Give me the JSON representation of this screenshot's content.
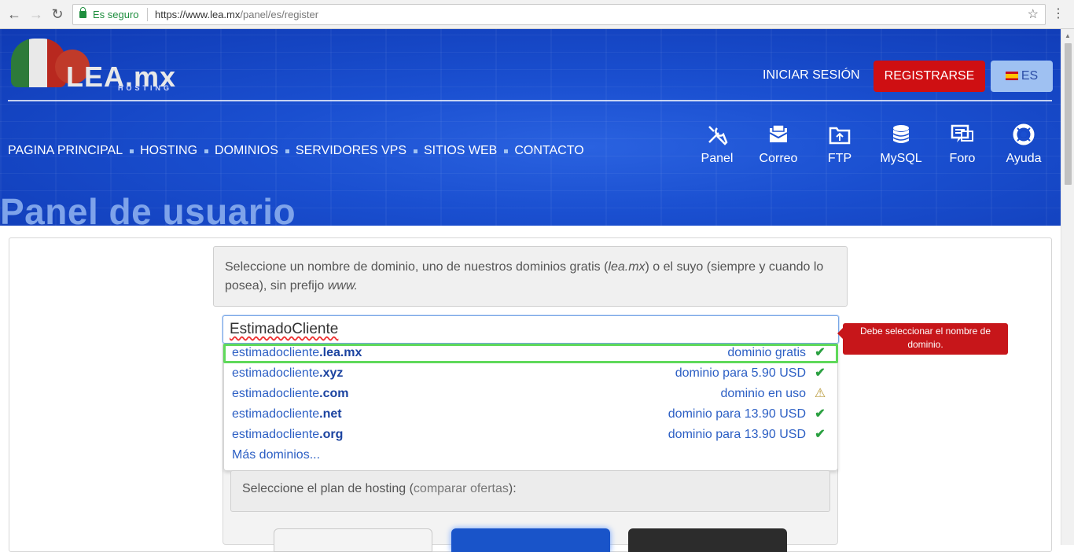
{
  "browser": {
    "secure_label": "Es seguro",
    "url_host": "https://www.lea.mx",
    "url_path": "/panel/es/register"
  },
  "header": {
    "logo_text": "LEA.mx",
    "logo_sub": "HOSTING",
    "login": "INICIAR SESIÓN",
    "register": "REGISTRARSE",
    "language": "ES"
  },
  "nav": [
    "PAGINA PRINCIPAL",
    "HOSTING",
    "DOMINIOS",
    "SERVIDORES VPS",
    "SITIOS WEB",
    "CONTACTO"
  ],
  "tools": [
    {
      "label": "Panel",
      "icon": "tools-icon"
    },
    {
      "label": "Correo",
      "icon": "mail-icon"
    },
    {
      "label": "FTP",
      "icon": "folder-icon"
    },
    {
      "label": "MySQL",
      "icon": "database-icon"
    },
    {
      "label": "Foro",
      "icon": "forum-icon"
    },
    {
      "label": "Ayuda",
      "icon": "lifebuoy-icon"
    }
  ],
  "page_title": "Panel de usuario",
  "intro": {
    "text_before": "Seleccione un nombre de dominio, uno de nuestros dominios gratis (",
    "free_domain": "lea.mx",
    "text_middle": ") o el suyo (siempre y cuando lo posea), sin prefijo ",
    "prefix": "www."
  },
  "domain_input": {
    "value": "EstimadoCliente"
  },
  "tooltip": "Debe seleccionar el nombre de dominio.",
  "domain_options": [
    {
      "name": "estimadocliente",
      "tld": ".lea.mx",
      "status": "dominio gratis",
      "icon": "check-icon"
    },
    {
      "name": "estimadocliente",
      "tld": ".xyz",
      "status": "dominio para 5.90 USD",
      "icon": "check-icon"
    },
    {
      "name": "estimadocliente",
      "tld": ".com",
      "status": "dominio en uso",
      "icon": "warning-icon"
    },
    {
      "name": "estimadocliente",
      "tld": ".net",
      "status": "dominio para 13.90 USD",
      "icon": "check-icon"
    },
    {
      "name": "estimadocliente",
      "tld": ".org",
      "status": "dominio para 13.90 USD",
      "icon": "check-icon"
    }
  ],
  "more_domains": "Más dominios...",
  "plan": {
    "text_before": "Seleccione el plan de hosting (",
    "link": "comparar ofertas",
    "text_after": "):"
  }
}
